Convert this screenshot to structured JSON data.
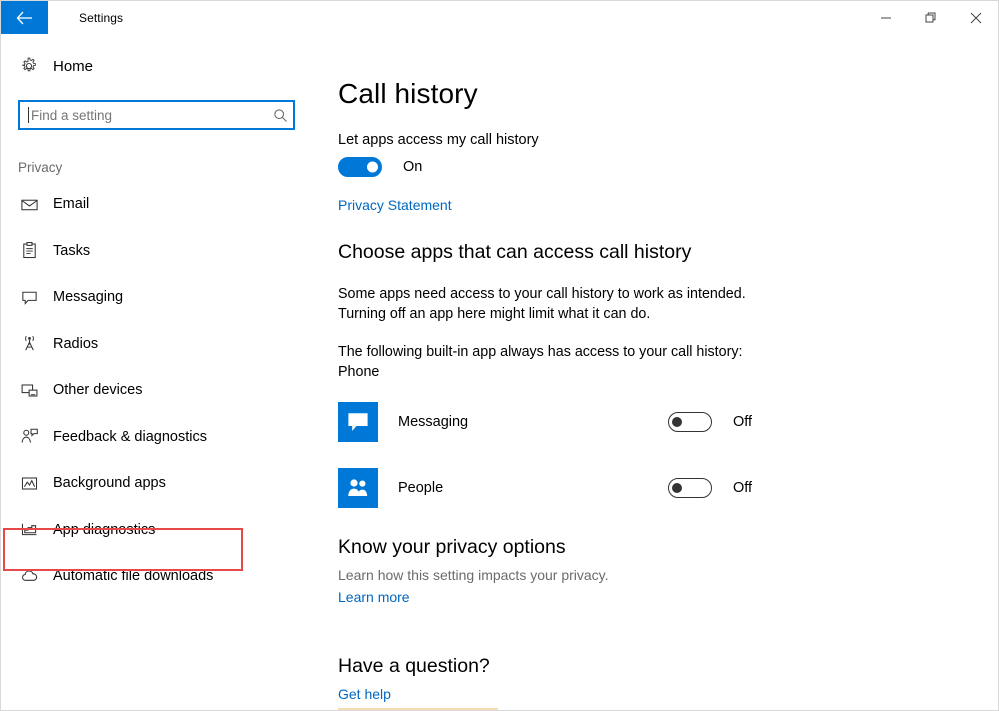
{
  "titlebar": {
    "back_label": "Back",
    "title": "Settings",
    "minimize_label": "Minimize",
    "restore_label": "Restore",
    "close_label": "Close"
  },
  "sidebar": {
    "home_label": "Home",
    "search": {
      "placeholder": "Find a setting",
      "value": ""
    },
    "section_label": "Privacy",
    "items": [
      {
        "label": "Email",
        "icon": "envelope-icon"
      },
      {
        "label": "Tasks",
        "icon": "clipboard-icon"
      },
      {
        "label": "Messaging",
        "icon": "speech-bubble-icon"
      },
      {
        "label": "Radios",
        "icon": "antenna-icon"
      },
      {
        "label": "Other devices",
        "icon": "devices-icon"
      },
      {
        "label": "Feedback & diagnostics",
        "icon": "person-feedback-icon"
      },
      {
        "label": "Background apps",
        "icon": "picture-frame-icon"
      },
      {
        "label": "App diagnostics",
        "icon": "chart-icon"
      },
      {
        "label": "Automatic file downloads",
        "icon": "cloud-icon"
      }
    ],
    "highlighted_item": "Background apps",
    "highlight_color": "#e74848"
  },
  "main": {
    "page_title": "Call history",
    "master_toggle": {
      "label": "Let apps access my call history",
      "state": "On",
      "enabled": true
    },
    "privacy_statement_link": "Privacy Statement",
    "choose_apps_heading": "Choose apps that can access call history",
    "description_1": "Some apps need access to your call history to work as intended. Turning off an app here might limit what it can do.",
    "description_2": "The following built-in app always has access to your call history: Phone",
    "apps": [
      {
        "name": "Messaging",
        "state": "Off",
        "enabled": false,
        "icon": "messaging-app-icon",
        "tile_color": "#0078d7"
      },
      {
        "name": "People",
        "state": "Off",
        "enabled": false,
        "icon": "people-app-icon",
        "tile_color": "#0078d7"
      }
    ],
    "privacy_options": {
      "heading": "Know your privacy options",
      "description": "Learn how this setting impacts your privacy.",
      "link": "Learn more"
    },
    "question": {
      "heading": "Have a question?",
      "link": "Get help"
    }
  },
  "colors": {
    "accent": "#0078d7",
    "link": "#0067c0",
    "highlight": "#e74848"
  }
}
